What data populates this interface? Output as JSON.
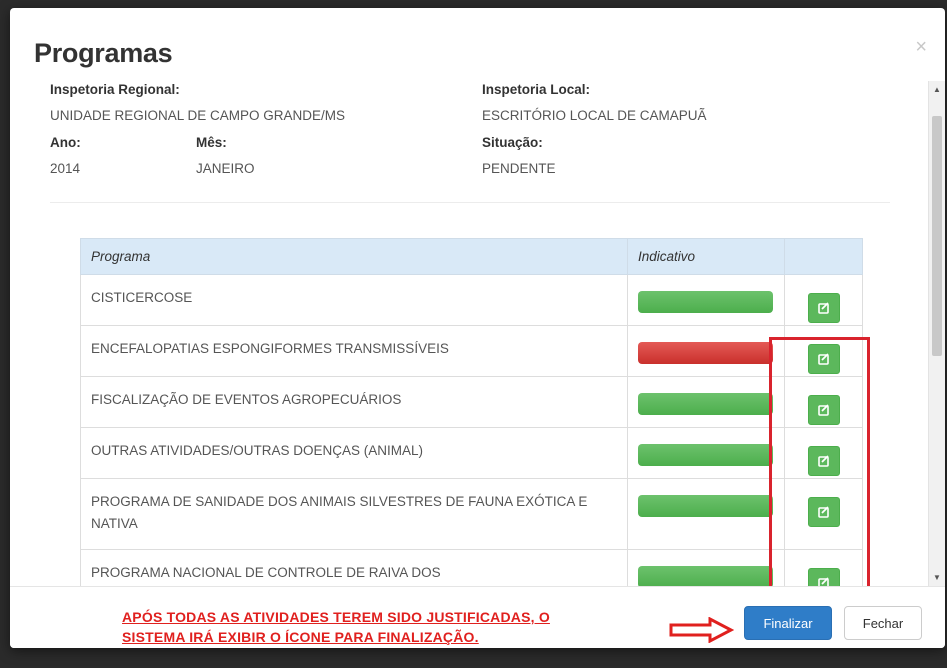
{
  "modal": {
    "title": "Programas",
    "close_label": "×"
  },
  "info": {
    "inspetoria_regional_label": "Inspetoria Regional:",
    "inspetoria_regional_value": "UNIDADE REGIONAL DE CAMPO GRANDE/MS",
    "inspetoria_local_label": "Inspetoria Local:",
    "inspetoria_local_value": "ESCRITÓRIO LOCAL DE CAMAPUÃ",
    "ano_label": "Ano:",
    "ano_value": "2014",
    "mes_label": "Mês:",
    "mes_value": "JANEIRO",
    "situacao_label": "Situação:",
    "situacao_value": "PENDENTE"
  },
  "table": {
    "headers": [
      "Programa",
      "Indicativo",
      ""
    ],
    "rows": [
      {
        "programa": "CISTICERCOSE",
        "indicativo": "green"
      },
      {
        "programa": "ENCEFALOPATIAS ESPONGIFORMES TRANSMISSÍVEIS",
        "indicativo": "red"
      },
      {
        "programa": "FISCALIZAÇÃO DE EVENTOS AGROPECUÁRIOS",
        "indicativo": "green"
      },
      {
        "programa": "OUTRAS ATIVIDADES/OUTRAS DOENÇAS (ANIMAL)",
        "indicativo": "green"
      },
      {
        "programa": "PROGRAMA DE SANIDADE DOS ANIMAIS SILVESTRES DE FAUNA EXÓTICA E NATIVA",
        "indicativo": "green"
      },
      {
        "programa": "PROGRAMA NACIONAL DE CONTROLE DE RAIVA DOS",
        "indicativo": "green"
      }
    ]
  },
  "footer": {
    "note_line1": "APÓS TODAS AS ATIVIDADES TEREM SIDO JUSTIFICADAS, O",
    "note_line2": "SISTEMA IRÁ EXIBIR O ÍCONE PARA FINALIZAÇÃO.",
    "finalizar_label": "Finalizar",
    "fechar_label": "Fechar"
  },
  "colors": {
    "green": "#5cb85c",
    "red": "#d9534f",
    "primary": "#2f7dc8",
    "annotation": "#e0201e"
  },
  "icons": {
    "row_action": "edit-icon",
    "annotation_arrow": "arrow-right-icon"
  }
}
